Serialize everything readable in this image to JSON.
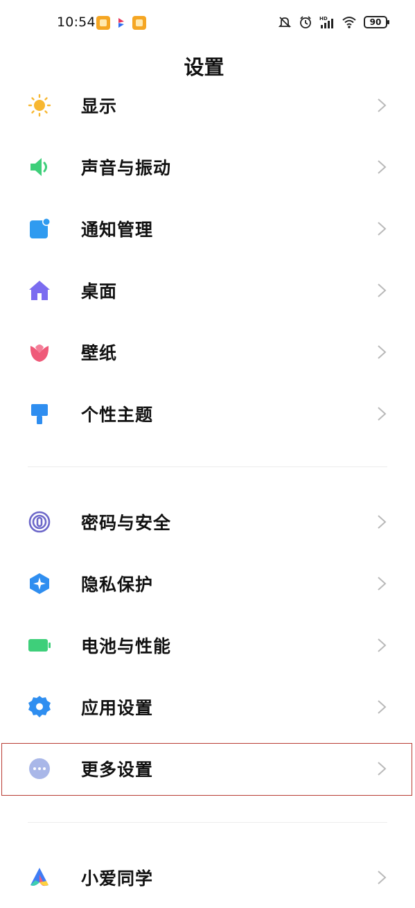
{
  "status_bar": {
    "time": "10:54",
    "battery": "90",
    "icons": [
      "mute-bell-icon",
      "alarm-icon",
      "hd-signal-icon",
      "wifi-icon",
      "battery-icon"
    ]
  },
  "header": {
    "title": "设置"
  },
  "groups": [
    {
      "items": [
        {
          "label": "显示",
          "icon": "sun-icon",
          "color": "#f7b731"
        },
        {
          "label": "声音与振动",
          "icon": "speaker-icon",
          "color": "#3ecf7a"
        },
        {
          "label": "通知管理",
          "icon": "notification-icon",
          "color": "#2f9bf0"
        },
        {
          "label": "桌面",
          "icon": "home-icon",
          "color": "#7b6cf0"
        },
        {
          "label": "壁纸",
          "icon": "tulip-icon",
          "color": "#ef5a79"
        },
        {
          "label": "个性主题",
          "icon": "brush-icon",
          "color": "#2f8ef0"
        }
      ]
    },
    {
      "items": [
        {
          "label": "密码与安全",
          "icon": "fingerprint-icon",
          "color": "#6c67c9"
        },
        {
          "label": "隐私保护",
          "icon": "privacy-shield-icon",
          "color": "#2f8ef0"
        },
        {
          "label": "电池与性能",
          "icon": "battery-icon",
          "color": "#3ecf7a"
        },
        {
          "label": "应用设置",
          "icon": "gear-icon",
          "color": "#2f8ef0"
        },
        {
          "label": "更多设置",
          "icon": "more-dots-icon",
          "color": "#a9b7e8"
        }
      ]
    },
    {
      "items": [
        {
          "label": "小爱同学",
          "icon": "xiaoai-icon",
          "color": "#3f7cf5"
        }
      ]
    }
  ]
}
